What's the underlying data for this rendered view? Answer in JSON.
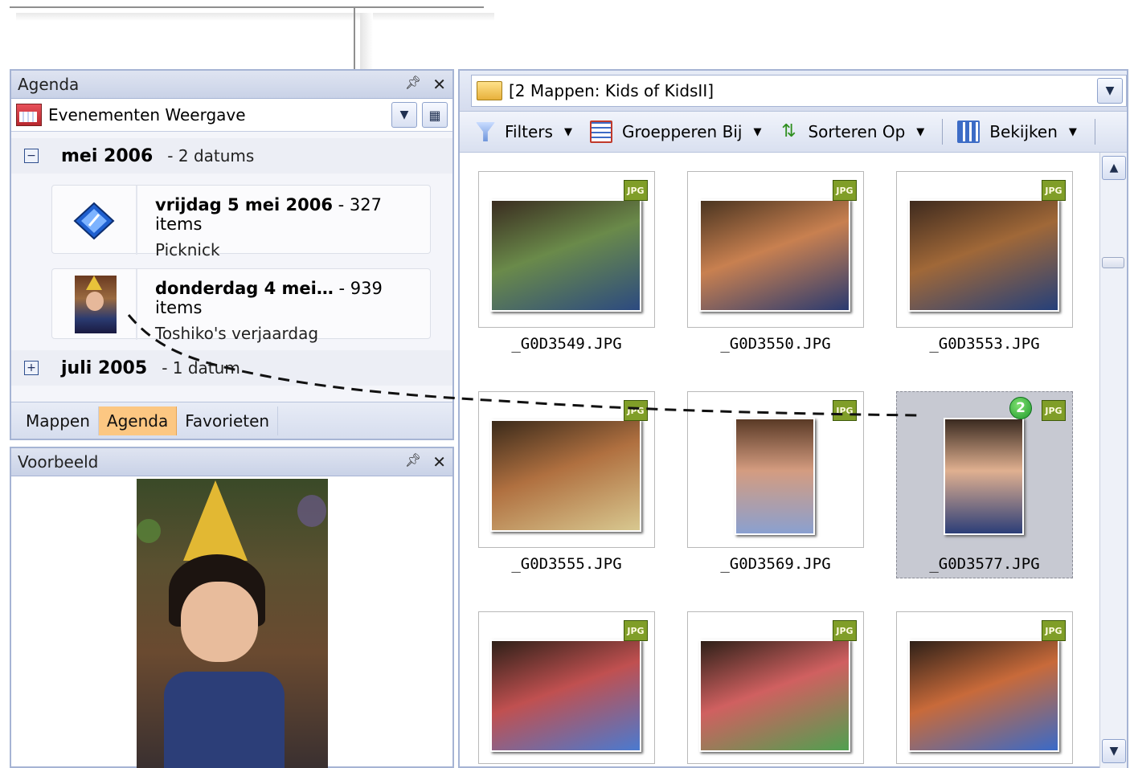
{
  "left": {
    "agenda_title": "Agenda",
    "pin_icon": "⊓",
    "close_icon": "✕",
    "view_combo_label": "Evenementen Weergave",
    "groups": [
      {
        "toggle": "⊟",
        "label": "mei 2006",
        "count": "- 2 datums"
      },
      {
        "toggle": "⊞",
        "label": "juli 2005",
        "count": "- 1 datum"
      }
    ],
    "events": [
      {
        "date": "vrijdag 5 mei 2006",
        "items": " - 327 items",
        "name": "Picknick"
      },
      {
        "date": "donderdag 4 mei…",
        "items": " - 939 items",
        "name": "Toshiko's verjaardag"
      }
    ],
    "tabs": [
      "Mappen",
      "Agenda",
      "Favorieten"
    ],
    "active_tab": "Agenda",
    "preview_title": "Voorbeeld"
  },
  "right": {
    "address": "[2 Mappen: Kids of KidsII]",
    "toolbar": {
      "filters": "Filters",
      "group_by": "Groepperen Bij",
      "sort_by": "Sorteren Op",
      "view": "Bekijken"
    },
    "thumbnails": [
      {
        "file": "_G0D3549.JPG",
        "badge": "JPG",
        "orientation": "landscape",
        "selected": false
      },
      {
        "file": "_G0D3550.JPG",
        "badge": "JPG",
        "orientation": "landscape",
        "selected": false
      },
      {
        "file": "_G0D3553.JPG",
        "badge": "JPG",
        "orientation": "landscape",
        "selected": false
      },
      {
        "file": "_G0D3555.JPG",
        "badge": "JPG",
        "orientation": "landscape",
        "selected": false
      },
      {
        "file": "_G0D3569.JPG",
        "badge": "JPG",
        "orientation": "portrait",
        "selected": false
      },
      {
        "file": "_G0D3577.JPG",
        "badge": "JPG",
        "orientation": "portrait",
        "selected": true,
        "count_badge": "2"
      },
      {
        "file": "",
        "badge": "JPG",
        "orientation": "landscape",
        "selected": false
      },
      {
        "file": "",
        "badge": "JPG",
        "orientation": "landscape",
        "selected": false
      },
      {
        "file": "",
        "badge": "JPG",
        "orientation": "landscape",
        "selected": false
      }
    ]
  },
  "colors": {
    "pane_border": "#a6b4d4",
    "active_tab": "#fcc782",
    "selection": "#c7c9d2",
    "jpg_badge": "#809e28"
  }
}
